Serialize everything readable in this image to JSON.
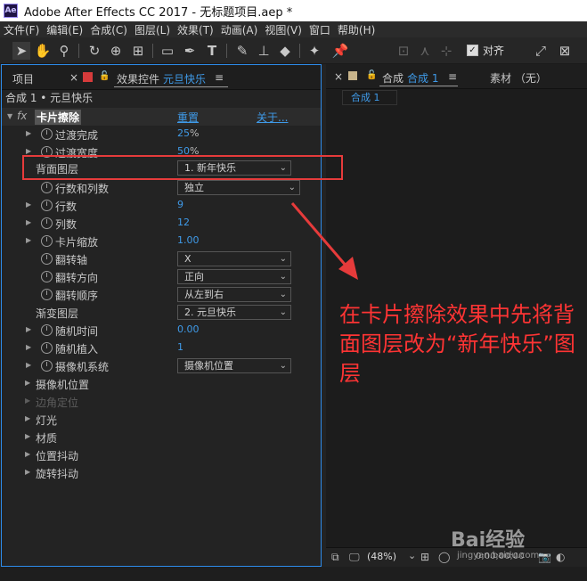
{
  "window": {
    "title": "Adobe After Effects CC 2017 - 无标题项目.aep *",
    "logo": "Ae"
  },
  "menu": [
    "文件(F)",
    "编辑(E)",
    "合成(C)",
    "图层(L)",
    "效果(T)",
    "动画(A)",
    "视图(V)",
    "窗口",
    "帮助(H)"
  ],
  "toolbar": {
    "snap_label": "对齐",
    "snap_check": "✓",
    "icons": [
      "selection-arrow-icon",
      "hand-icon",
      "zoom-icon",
      "rotate-icon",
      "camera-orbit-icon",
      "pan-behind-icon",
      "rectangle-icon",
      "pen-icon",
      "text-icon",
      "brush-icon",
      "clone-stamp-icon",
      "eraser-icon",
      "roto-brush-icon",
      "puppet-pin-icon"
    ]
  },
  "left_panel": {
    "tab_project": "项目",
    "tab_effects_prefix": "效果控件",
    "tab_effects_layer": "元旦快乐",
    "menu_icon": "≡",
    "close_icon": "×",
    "lock_icon": "🔓",
    "path": "合成 1 • 元旦快乐",
    "effect": {
      "fx": "fx",
      "name": "卡片擦除",
      "reset": "重置",
      "about": "关于..."
    },
    "rows": [
      {
        "label": "过渡完成",
        "value": "25",
        "unit": "%"
      },
      {
        "label": "过渡宽度",
        "value": "50",
        "unit": "%"
      },
      {
        "label": "背面图层",
        "dropdown": "1. 新年快乐"
      },
      {
        "label": "行数和列数",
        "dropdown": "独立"
      },
      {
        "label": "行数",
        "value": "9"
      },
      {
        "label": "列数",
        "value": "12"
      },
      {
        "label": "卡片缩放",
        "value": "1.00"
      },
      {
        "label": "翻转轴",
        "dropdown": "X"
      },
      {
        "label": "翻转方向",
        "dropdown": "正向"
      },
      {
        "label": "翻转顺序",
        "dropdown": "从左到右"
      },
      {
        "label": "渐变图层",
        "dropdown": "2. 元旦快乐"
      },
      {
        "label": "随机时间",
        "value": "0.00"
      },
      {
        "label": "随机植入",
        "value": "1"
      },
      {
        "label": "摄像机系统",
        "dropdown": "摄像机位置"
      },
      {
        "label": "摄像机位置"
      },
      {
        "label": "边角定位"
      },
      {
        "label": "灯光"
      },
      {
        "label": "材质"
      },
      {
        "label": "位置抖动"
      },
      {
        "label": "旋转抖动"
      }
    ]
  },
  "right_panel": {
    "close_icon": "×",
    "menu_icon": "≡",
    "tab_prefix": "合成",
    "tab_comp": "合成 1",
    "tab_footage": "素材 （无）",
    "subtab": "合成 1",
    "zoom": "(48%)",
    "timecode": "0;00;00;00"
  },
  "annotation": "在卡片擦除效果中先将背面图层改为“新年快乐”图层",
  "watermark": {
    "text": "Bai经验",
    "url": "jingyan.baidu.com"
  },
  "colors": {
    "accent": "#3f9ae8",
    "highlight": "#e63b3b",
    "annotation": "#ff3434",
    "panel_border": "#2d8ceb"
  }
}
